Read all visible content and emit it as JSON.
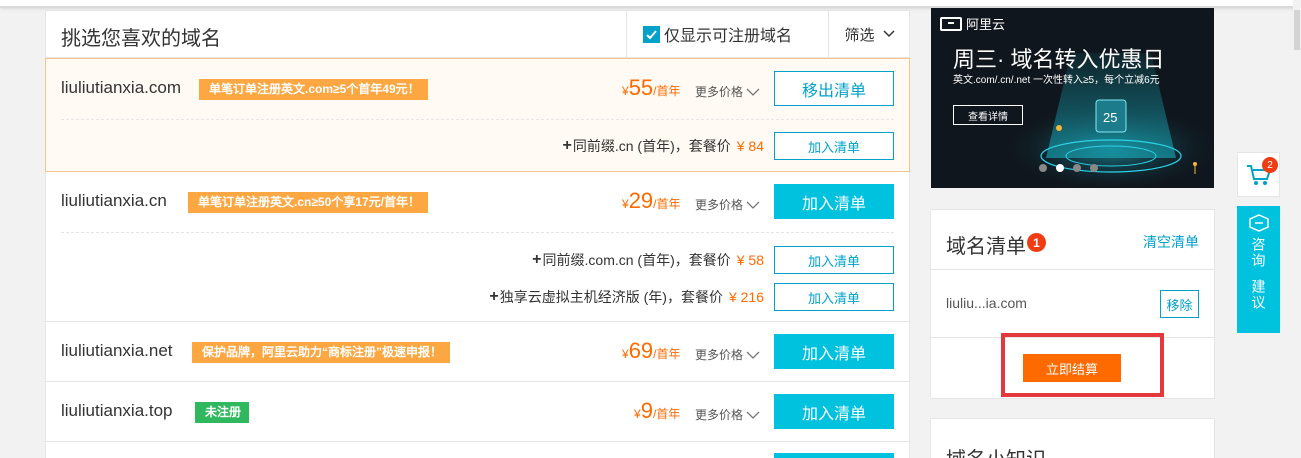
{
  "header": {
    "title": "挑选您喜欢的域名",
    "only_available_label": "仅显示可注册域名",
    "filter_label": "筛选"
  },
  "domains": [
    {
      "name": "liuliutianxia.com",
      "tag": "单笔订单注册英文.com≥5个首年49元！",
      "tag_color": "#fca742",
      "currency": "¥",
      "price": "55",
      "unit": "/首年",
      "more_prices": "更多价格",
      "action": "移出清单",
      "bundles": [
        {
          "label": "同前缀.cn (首年)，套餐价",
          "price": "¥ 84",
          "action": "加入清单"
        }
      ]
    },
    {
      "name": "liuliutianxia.cn",
      "tag": "单笔订单注册英文.cn≥50个享17元/首年！",
      "tag_color": "#fca742",
      "currency": "¥",
      "price": "29",
      "unit": "/首年",
      "more_prices": "更多价格",
      "action": "加入清单",
      "bundles": [
        {
          "label": "同前缀.com.cn (首年)，套餐价",
          "price": "¥ 58",
          "action": "加入清单"
        },
        {
          "label": "独享云虚拟主机经济版 (年)，套餐价",
          "price": "¥ 216",
          "action": "加入清单"
        }
      ]
    },
    {
      "name": "liuliutianxia.net",
      "tag": "保护品牌，阿里云助力“商标注册”极速申报！",
      "tag_color": "#fca742",
      "currency": "¥",
      "price": "69",
      "unit": "/首年",
      "more_prices": "更多价格",
      "action": "加入清单"
    },
    {
      "name": "liuliutianxia.top",
      "tag": "未注册",
      "tag_color": "#30b85e",
      "currency": "¥",
      "price": "9",
      "unit": "/首年",
      "more_prices": "更多价格",
      "action": "加入清单"
    }
  ],
  "banner": {
    "logo_text": "阿里云",
    "title": "周三· 域名转入优惠日",
    "subtitle": "英文.com/.cn/.net 一次性转入≥5，每个立减6元",
    "button": "查看详情",
    "slide_count": 4,
    "active_slide": 2
  },
  "cart": {
    "title": "域名清单",
    "count": "1",
    "clear_label": "清空清单",
    "items": [
      {
        "name": "liuliu...ia.com",
        "remove_label": "移除"
      }
    ],
    "checkout_label": "立即结算"
  },
  "tips": {
    "title": "域名小知识"
  },
  "float": {
    "cart_badge": "2",
    "consult_label": "咨询",
    "suggest_label": "建议"
  },
  "colors": {
    "accent": "#00c1de",
    "price": "#ff6a00",
    "tag_orange": "#fca742",
    "tag_green": "#30b85e",
    "highlight_box": "#e4393c"
  }
}
